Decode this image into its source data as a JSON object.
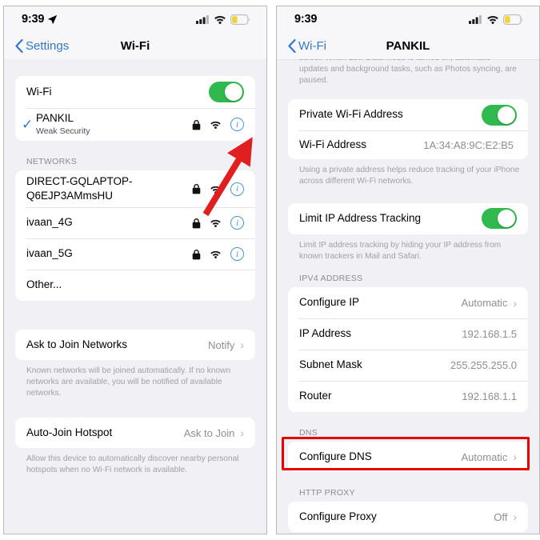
{
  "left_panel": {
    "status_bar": {
      "time": "9:39",
      "location_icon": "location-arrow-icon",
      "cellular_icon": "cellular-bars-icon",
      "wifi_icon": "wifi-icon",
      "battery_icon": "battery-low-power-icon",
      "battery_color": "#f2d23a"
    },
    "nav": {
      "back_label": "Settings",
      "title": "Wi-Fi"
    },
    "wifi_toggle_row": {
      "label": "Wi-Fi",
      "enabled": true
    },
    "connected_network": {
      "name": "PANKIL",
      "subtitle": "Weak Security",
      "checked": true,
      "lock_icon": "lock-icon",
      "signal_icon": "wifi-signal-icon",
      "info_icon": "info-circle-icon"
    },
    "networks_header": "NETWORKS",
    "networks": [
      {
        "name": "DIRECT-GQLAPTOP-Q6EJP3AMmsHU",
        "locked": true,
        "has_info": true
      },
      {
        "name": "ivaan_4G",
        "locked": true,
        "has_info": true
      },
      {
        "name": "ivaan_5G",
        "locked": true,
        "has_info": true
      },
      {
        "name": "Other...",
        "locked": false,
        "has_info": false
      }
    ],
    "ask_to_join": {
      "label": "Ask to Join Networks",
      "value": "Notify",
      "footnote": "Known networks will be joined automatically. If no known networks are available, you will be notified of available networks."
    },
    "auto_join_hotspot": {
      "label": "Auto-Join Hotspot",
      "value": "Ask to Join",
      "footnote": "Allow this device to automatically discover nearby personal hotspots when no Wi-Fi network is available."
    }
  },
  "right_panel": {
    "status_bar": {
      "time": "9:39",
      "cellular_icon": "cellular-bars-icon",
      "wifi_icon": "wifi-icon",
      "battery_icon": "battery-low-power-icon"
    },
    "nav": {
      "back_label": "Wi-Fi",
      "title": "PANKIL"
    },
    "top_cut_footnote": "select. When Low Data Mode is turned on, automatic updates and background tasks, such as Photos syncing, are paused.",
    "private_address": {
      "toggle_label": "Private Wi-Fi Address",
      "toggle_enabled": true,
      "mac_label": "Wi-Fi Address",
      "mac_value": "1A:34:A8:9C:E2:B5",
      "footnote": "Using a private address helps reduce tracking of your iPhone across different Wi-Fi networks."
    },
    "limit_ip": {
      "label": "Limit IP Address Tracking",
      "enabled": true,
      "footnote": "Limit IP address tracking by hiding your IP address from known trackers in Mail and Safari."
    },
    "ipv4": {
      "header": "IPV4 ADDRESS",
      "rows": [
        {
          "label": "Configure IP",
          "value": "Automatic",
          "chevron": true
        },
        {
          "label": "IP Address",
          "value": "192.168.1.5",
          "chevron": false
        },
        {
          "label": "Subnet Mask",
          "value": "255.255.255.0",
          "chevron": false
        },
        {
          "label": "Router",
          "value": "192.168.1.1",
          "chevron": false
        }
      ]
    },
    "dns": {
      "header": "DNS",
      "row": {
        "label": "Configure DNS",
        "value": "Automatic",
        "chevron": true
      },
      "highlighted": true
    },
    "http_proxy": {
      "header": "HTTP PROXY",
      "row": {
        "label": "Configure Proxy",
        "value": "Off",
        "chevron": true
      }
    }
  },
  "annotations": {
    "arrow_color": "#e02020",
    "highlight_color": "#e60000",
    "arrow_name": "red-arrow-pointing-to-info-button",
    "highlight_name": "red-highlight-box-configure-dns"
  },
  "colors": {
    "toggle_green": "#2fb94e",
    "accent_blue": "#3478c6",
    "info_blue": "#4a94d6",
    "background": "#f1f0f5",
    "card": "#ffffff",
    "secondary_text": "#8e8e93"
  }
}
